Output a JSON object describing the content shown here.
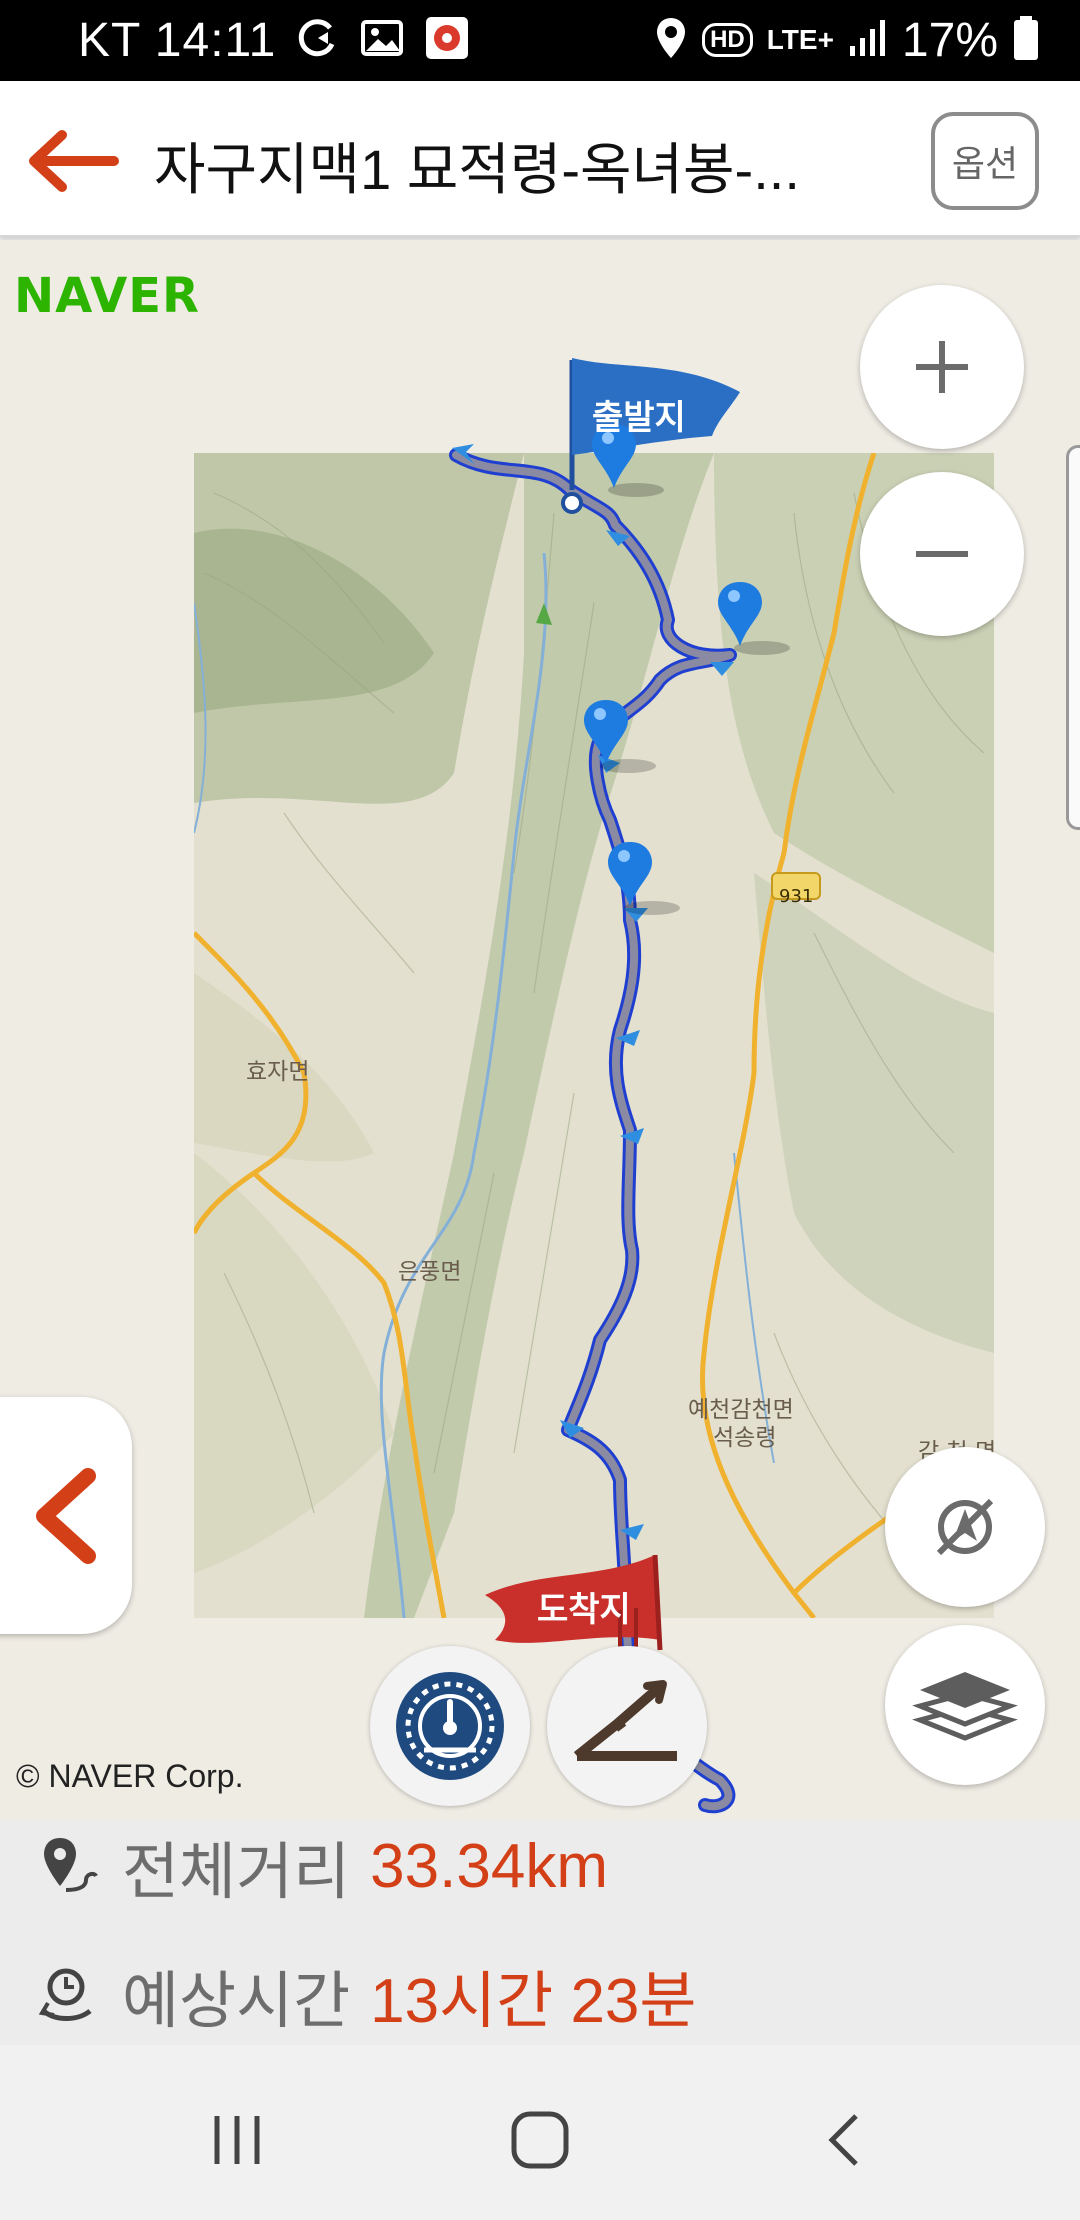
{
  "status_bar": {
    "carrier_time": "KT 14:11",
    "hd_label": "HD",
    "network_label": "LTE+",
    "battery": "17%"
  },
  "app_bar": {
    "title": "자구지맥1 묘적령-옥녀봉-...",
    "option_label": "옵션"
  },
  "map": {
    "brand": "NAVER",
    "start_flag": "출발지",
    "end_flag": "도착지",
    "labels": {
      "hyoja": "효자면",
      "eunpung": "은풍면",
      "yecheon_line1": "예천감천면",
      "yecheon_line2": "석송령",
      "gamcheon": "감 천 면",
      "road": "931"
    },
    "copyright": "© NAVER Corp."
  },
  "route_info": {
    "distance_label": "전체거리",
    "distance_value": "33.34km",
    "time_label": "예상시간",
    "time_value": "13시간 23분"
  },
  "colors": {
    "accent": "#d34017",
    "naver_green": "#2db400",
    "route_blue": "#1f4fd8",
    "start_flag": "#2a6fc4",
    "end_flag": "#c9302c"
  }
}
